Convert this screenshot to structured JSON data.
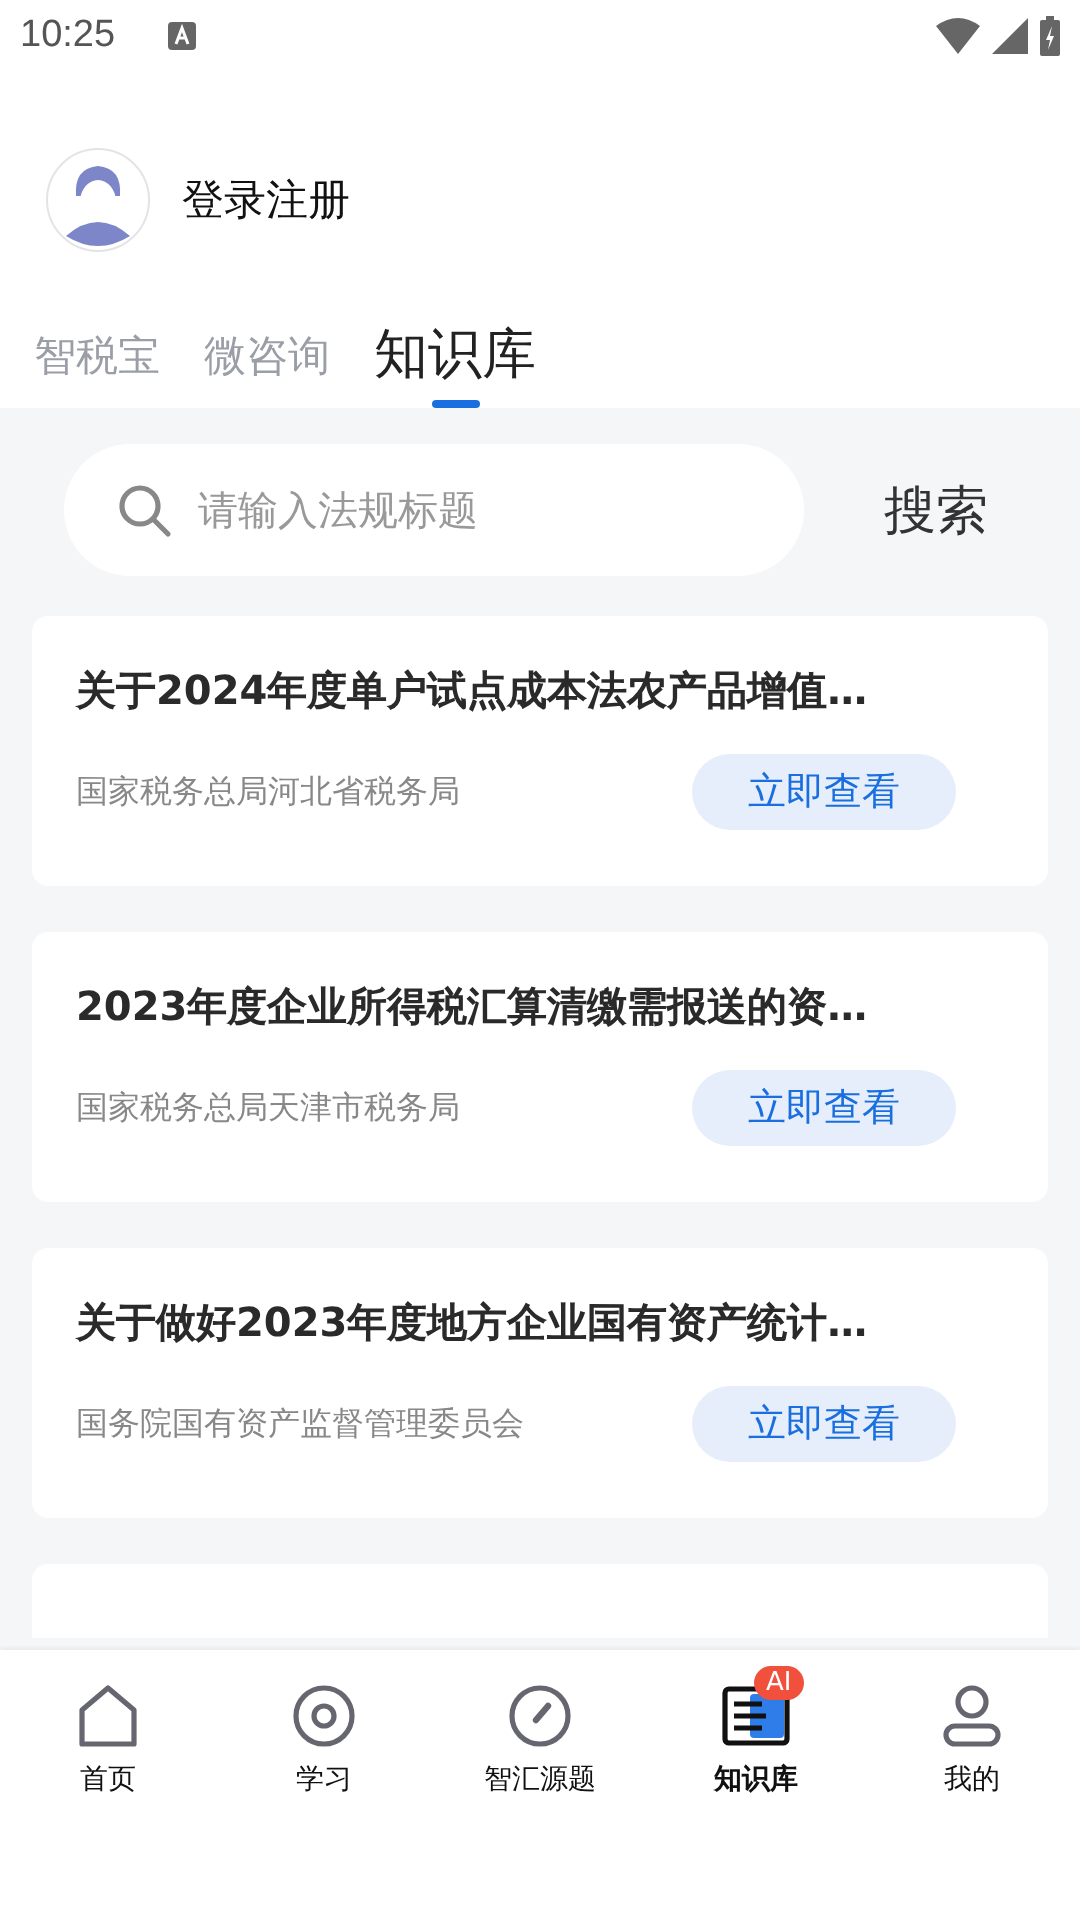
{
  "status_bar": {
    "time": "10:25"
  },
  "profile": {
    "name": "登录注册"
  },
  "tabs": [
    {
      "label": "智税宝",
      "selected": false
    },
    {
      "label": "微咨询",
      "selected": false
    },
    {
      "label": "知识库",
      "selected": true
    }
  ],
  "search": {
    "placeholder": "请输入法规标题",
    "button": "搜索"
  },
  "cards": [
    {
      "title": "关于2024年度单户试点成本法农产品增值…",
      "source": "国家税务总局河北省税务局",
      "action": "立即查看"
    },
    {
      "title": "2023年度企业所得税汇算清缴需报送的资…",
      "source": "国家税务总局天津市税务局",
      "action": "立即查看"
    },
    {
      "title": "关于做好2023年度地方企业国有资产统计…",
      "source": "国务院国有资产监督管理委员会",
      "action": "立即查看"
    },
    {
      "kind": "partial"
    }
  ],
  "nav": [
    {
      "label": "首页",
      "kind": "home",
      "selected": false
    },
    {
      "label": "学习",
      "kind": "study",
      "selected": false
    },
    {
      "label": "智汇源题",
      "kind": "quiz",
      "selected": false
    },
    {
      "label": "知识库",
      "kind": "library",
      "selected": true,
      "badge": "AI"
    },
    {
      "label": "我的",
      "kind": "me",
      "selected": false
    }
  ]
}
